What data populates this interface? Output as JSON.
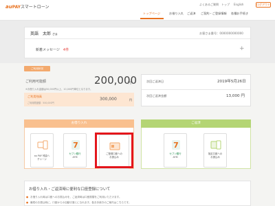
{
  "header": {
    "logo": {
      "au": "au",
      "pay": "PAY",
      "loan": "スマートローン"
    },
    "links": {
      "faq": "よくあるご質問",
      "top": "トップ",
      "english": "English"
    },
    "logout_label": "ログアウト",
    "nav": [
      "トップページ",
      "お借り入れ",
      "ご返済",
      "ご契約・ご登録情報",
      "各種お手続き"
    ]
  },
  "user": {
    "name": "英語　太郎",
    "honorific": "さま",
    "member_no": "お客さま番号：0000000000000",
    "message_label": "新着メッセージ",
    "message_count": "4件"
  },
  "status": {
    "tag": "ご利用状況",
    "limit_label": "ご利用可能額",
    "limit_value": "200,000",
    "limit_unit": "円",
    "limit_note": "※お借り入れ金額は50,000円以上、10,000円単位となります。",
    "used_label": "ご利用残高",
    "used_sub": "ご利用限度額：500,000円",
    "used_value": "300,000",
    "used_unit": "円",
    "due_label": "次回ご返済日",
    "due_value": "2019年5月26日",
    "amount_label": "次回ご返済金額",
    "amount_value": "13,000 円"
  },
  "borrow": {
    "header": "お借り入れ",
    "cards": [
      {
        "label_1": "au PAY 残高へ",
        "label_2": "チャージ",
        "icon": "au-pay-charge-icon"
      },
      {
        "label_1": "セブン銀行",
        "label_2": "ATM",
        "icon": "seven-bank-icon"
      },
      {
        "label_1": "ご登録口座への",
        "label_2": "お振込み",
        "icon": "bank-transfer-icon"
      }
    ]
  },
  "repay": {
    "header": "ご返済",
    "cards": [
      {
        "label_1": "セブン銀行",
        "label_2": "ATM",
        "icon": "seven-bank-icon"
      },
      {
        "label_1": "指定口座への",
        "label_2": "お振込み",
        "icon": "bank-transfer-icon"
      }
    ]
  },
  "info": {
    "title": "お借り入れ・ご返済時に便利な口座登録について",
    "lines": [
      "お借り入れ時は口座へのお振込みを、ご返済時は口座振替をご利用いただけます。",
      "最短のお振込時に、口座からの自動引落とになれます。各お手続きのご案内はこちらです。"
    ]
  },
  "colors": {
    "accent": "#e8711e",
    "borrow": "#f9c08f",
    "repay": "#b4d574",
    "highlight": "#e4151b"
  }
}
